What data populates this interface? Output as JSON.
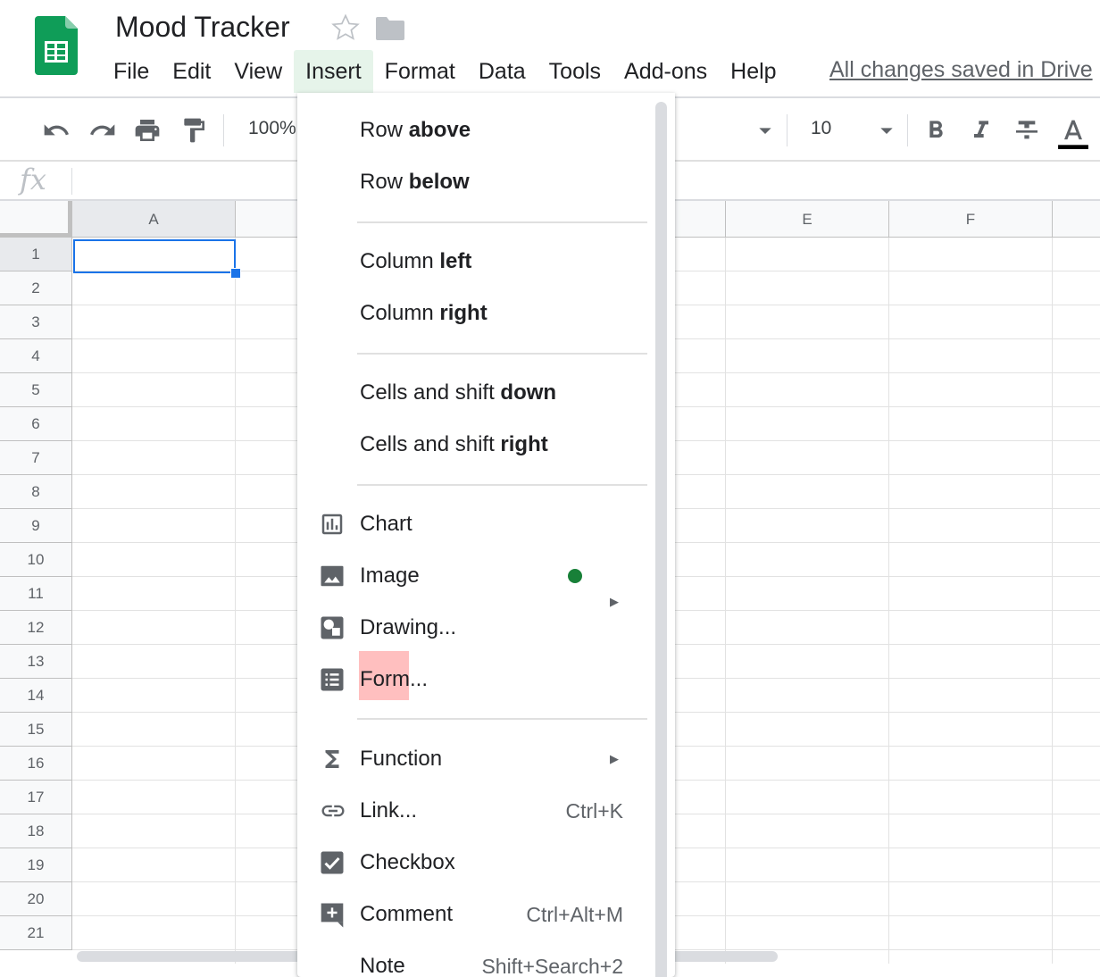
{
  "header": {
    "title": "Mood Tracker",
    "save_status": "All changes saved in Drive"
  },
  "menubar": {
    "items": [
      "File",
      "Edit",
      "View",
      "Insert",
      "Format",
      "Data",
      "Tools",
      "Add-ons",
      "Help"
    ],
    "active": "Insert"
  },
  "toolbar": {
    "zoom": "100%",
    "font_size": "10"
  },
  "formula_bar": {
    "fx_label": "fx",
    "value": ""
  },
  "grid": {
    "column_headers": [
      "A",
      "",
      "",
      "",
      "E",
      "F",
      ""
    ],
    "row_headers": [
      "1",
      "2",
      "3",
      "4",
      "5",
      "6",
      "7",
      "8",
      "9",
      "10",
      "11",
      "12",
      "13",
      "14",
      "15",
      "16",
      "17",
      "18",
      "19",
      "20",
      "21"
    ],
    "selected_cell": "A1"
  },
  "insert_menu": {
    "row_above": {
      "pre": "Row ",
      "bold": "above"
    },
    "row_below": {
      "pre": "Row ",
      "bold": "below"
    },
    "column_left": {
      "pre": "Column ",
      "bold": "left"
    },
    "column_right": {
      "pre": "Column ",
      "bold": "right"
    },
    "cells_down": {
      "pre": "Cells and shift ",
      "bold": "down"
    },
    "cells_right": {
      "pre": "Cells and shift ",
      "bold": "right"
    },
    "chart": "Chart",
    "image": "Image",
    "drawing": "Drawing...",
    "form": "Form...",
    "function": "Function",
    "link": "Link...",
    "link_shortcut": "Ctrl+K",
    "checkbox": "Checkbox",
    "comment": "Comment",
    "comment_shortcut": "Ctrl+Alt+M",
    "note": "Note",
    "note_shortcut": "Shift+Search+2"
  },
  "colors": {
    "sheets_green": "#0f9d58",
    "selection_blue": "#1a73e8",
    "active_menu_bg": "#e6f4ea",
    "new_badge_green": "#188038",
    "form_highlight": "#ffbfbf"
  },
  "icons": {
    "logo": "google-sheets-logo",
    "star": "star-outline-icon",
    "folder": "folder-icon",
    "undo": "undo-icon",
    "redo": "redo-icon",
    "print": "print-icon",
    "paint_format": "paint-format-icon",
    "bold": "bold-icon",
    "italic": "italic-icon",
    "strikethrough": "strikethrough-icon",
    "text_color": "text-color-icon",
    "chart": "chart-icon",
    "image": "image-icon",
    "drawing": "drawing-icon",
    "form": "form-icon",
    "function": "sigma-icon",
    "link": "link-icon",
    "checkbox": "checkbox-icon",
    "comment": "add-comment-icon"
  }
}
